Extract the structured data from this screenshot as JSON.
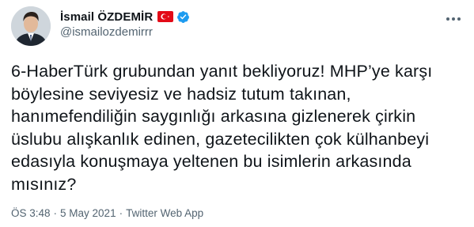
{
  "author": {
    "display_name": "İsmail ÖZDEMİR",
    "handle": "@ismailozdemirrr",
    "flag_icon": "turkey-flag-icon",
    "verified_icon": "verified-badge-icon"
  },
  "tweet": {
    "text": "6-HaberTürk grubundan yanıt bekliyoruz! MHP’ye karşı\nböylesine seviyesiz ve hadsiz tutum takınan,\nhanımefendiliğin saygınlığı arkasına gizlenerek çirkin\nüslubu alışkanlık edinen, gazetecilikten çok külhanbeyi\nedasıyla konuşmaya yeltenen bu isimlerin arkasında\nmısınız?",
    "time": "ÖS 3:48",
    "date": "5 May 2021",
    "source": "Twitter Web App",
    "separator": "·"
  },
  "colors": {
    "text": "#0f1419",
    "secondary": "#536471",
    "verified": "#1d9bf0",
    "flag_red": "#e30a17"
  }
}
